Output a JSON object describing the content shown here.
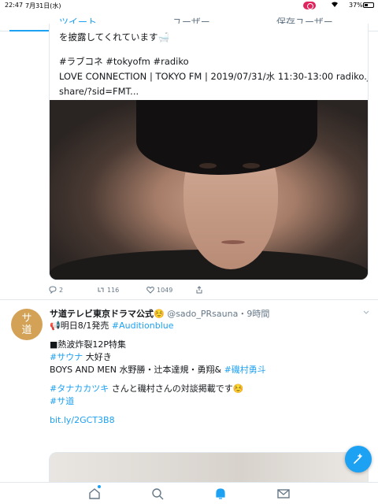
{
  "status_bar": {
    "time": "22:47",
    "date": "7月31日(水)",
    "battery": "37%",
    "battery_level": 0.37
  },
  "tabs": [
    {
      "label": "ツイート",
      "active": true
    },
    {
      "label": "ユーザー",
      "active": false
    },
    {
      "label": "保存ユーザー",
      "active": false
    }
  ],
  "tweet1": {
    "text_lines": [
      "を披露してくれています🛁",
      "",
      "#ラブコネ #tokyofm #radiko",
      "LOVE CONNECTION | TOKYO FM | 2019/07/31/水  11:30-13:00 radiko.jp/",
      "share/?sid=FMT..."
    ],
    "replies": "2",
    "retweets": "116",
    "likes": "1049"
  },
  "tweet2": {
    "avatar_text": "サ\n道",
    "name": "サ道テレビ東京ドラマ公式☺️",
    "handle": "@sado_PRsauna",
    "time": "・9時間",
    "line1_prefix": "📢明日8/1発売 ",
    "line1_link": "#Auditionblue",
    "line2": "■熱波炸裂12P特集",
    "line3_link": "#サウナ",
    "line3_rest": " 大好き",
    "line4_prefix": "BOYS AND MEN 水野勝・辻本達規・勇翔& ",
    "line4_link": "#磯村勇斗",
    "line5_link": "#タナカカツキ",
    "line5_rest": " さんと磯村さんの対談掲載です☺️",
    "line6_link": "#サ道",
    "url": "bit.ly/2GCT3B8"
  },
  "icons": {
    "reply": "reply-icon",
    "retweet": "retweet-icon",
    "like": "heart-icon",
    "share": "share-icon",
    "compose": "compose-icon",
    "home": "home-icon",
    "search": "search-icon",
    "notifications": "bell-icon",
    "messages": "mail-icon"
  },
  "colors": {
    "accent": "#1da1f2",
    "avatar": "#d4a257",
    "recording": "#e0245e"
  }
}
